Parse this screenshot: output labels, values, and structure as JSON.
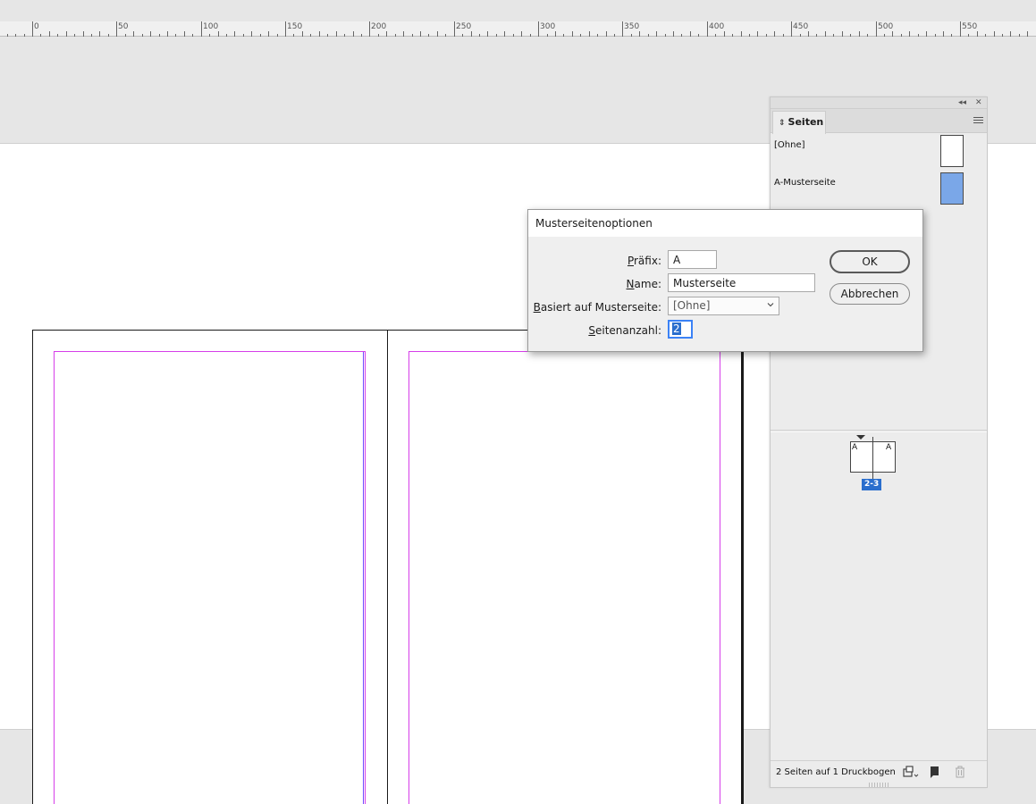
{
  "ruler": {
    "labels": [
      "0",
      "50",
      "100",
      "150",
      "200",
      "250",
      "300",
      "350",
      "400",
      "450",
      "500",
      "550"
    ]
  },
  "pages_panel": {
    "tab_label": "Seiten",
    "tab_icon": "updown-arrows-icon",
    "collapse_icon": "double-chevron-left-icon",
    "close_icon": "close-icon",
    "menu_icon": "panel-menu-icon",
    "masters": [
      {
        "label": "[Ohne]"
      },
      {
        "label": "A-Musterseite",
        "color": "#7aa7e8"
      }
    ],
    "spread": {
      "left_prefix": "A",
      "right_prefix": "A",
      "label": "2-3",
      "label_color": "#2a6ecd"
    },
    "footer": {
      "status": "2 Seiten auf 1 Druckbogen",
      "icons": [
        "page-size-icon",
        "new-page-icon",
        "trash-icon"
      ]
    }
  },
  "dialog": {
    "title": "Musterseitenoptionen",
    "prefix": {
      "label_ul": "P",
      "label_rest": "räfix:",
      "value": "A"
    },
    "name": {
      "label_ul": "N",
      "label_rest": "ame:",
      "value": "Musterseite"
    },
    "based_on": {
      "label_ul": "B",
      "label_rest": "asiert auf Musterseite:",
      "value": "[Ohne]"
    },
    "page_count": {
      "label_ul": "S",
      "label_rest": "eitenanzahl:",
      "value": "2"
    },
    "ok_label": "OK",
    "cancel_label": "Abbrechen"
  },
  "colors": {
    "margin_guide": "#d63ee9",
    "selection": "#2a6ecd"
  }
}
